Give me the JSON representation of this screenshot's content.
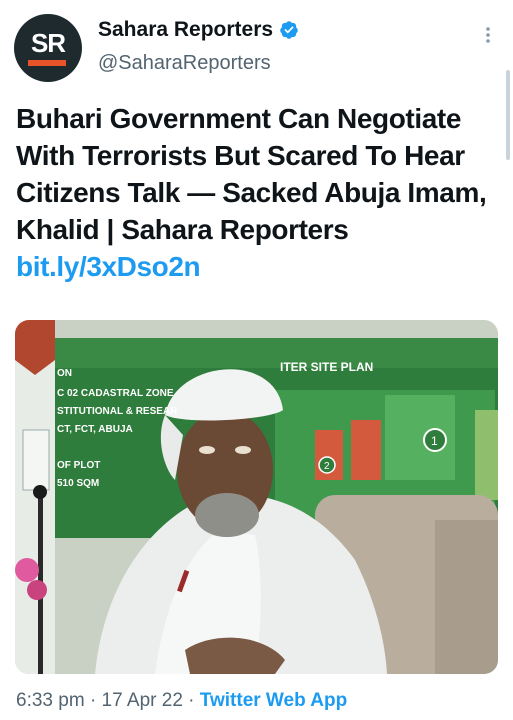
{
  "author": {
    "display_name": "Sahara Reporters",
    "handle": "@SaharaReporters",
    "avatar_initials": "SR"
  },
  "tweet": {
    "text": "Buhari Government Can Negotiate With Terrorists But Scared To Hear Citizens Talk — Sacked Abuja Imam, Khalid  | Sahara Reporters",
    "link": "bit.ly/3xDso2n"
  },
  "media": {
    "sign_title": "ITER SITE PLAN",
    "sign_lines": [
      "ON",
      "C 02 CADASTRAL ZONE",
      "STITUTIONAL & RESEAR",
      "CT, FCT, ABUJA",
      "OF PLOT",
      "510 SQM"
    ]
  },
  "meta": {
    "time": "6:33 pm",
    "separator": "·",
    "date": "17 Apr 22",
    "source": "Twitter Web App"
  },
  "colors": {
    "link": "#1d9bf0",
    "verified": "#1d9bf0",
    "secondary_text": "#536471",
    "avatar_accent": "#e8542a"
  }
}
